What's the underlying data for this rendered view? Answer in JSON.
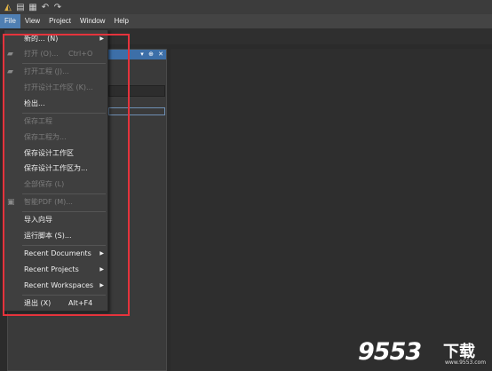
{
  "menubar": {
    "items": [
      {
        "label": "File",
        "active": true
      },
      {
        "label": "View",
        "active": false
      },
      {
        "label": "Project",
        "active": false
      },
      {
        "label": "Window",
        "active": false
      },
      {
        "label": "Help",
        "active": false
      }
    ]
  },
  "toolbar": {
    "icons": [
      "app-logo-icon",
      "copy-icon",
      "save-all-icon",
      "undo-icon",
      "redo-icon"
    ]
  },
  "panel": {
    "controls": [
      "pin-icon",
      "menu-icon",
      "close-icon"
    ]
  },
  "file_menu": {
    "items": [
      {
        "label": "新的... (N)",
        "shortcut": "",
        "submenu": true,
        "enabled": true
      },
      {
        "label": "打开 (O)...",
        "shortcut": "Ctrl+O",
        "submenu": false,
        "enabled": false,
        "icon": "folder-icon"
      },
      {
        "label": "打开工程 (J)...",
        "shortcut": "",
        "submenu": false,
        "enabled": false,
        "icon": "project-icon"
      },
      {
        "label": "打开设计工作区 (K)...",
        "shortcut": "",
        "submenu": false,
        "enabled": false
      },
      {
        "label": "检出...",
        "shortcut": "",
        "submenu": false,
        "enabled": true
      },
      {
        "label": "保存工程",
        "shortcut": "",
        "submenu": false,
        "enabled": false
      },
      {
        "label": "保存工程为...",
        "shortcut": "",
        "submenu": false,
        "enabled": false
      },
      {
        "label": "保存设计工作区",
        "shortcut": "",
        "submenu": false,
        "enabled": true
      },
      {
        "label": "保存设计工作区为...",
        "shortcut": "",
        "submenu": false,
        "enabled": true
      },
      {
        "label": "全部保存 (L)",
        "shortcut": "",
        "submenu": false,
        "enabled": false
      },
      {
        "label": "智能PDF (M)...",
        "shortcut": "",
        "submenu": false,
        "enabled": false,
        "icon": "pdf-icon"
      },
      {
        "label": "导入向导",
        "shortcut": "",
        "submenu": false,
        "enabled": true
      },
      {
        "label": "运行脚本 (S)...",
        "shortcut": "",
        "submenu": false,
        "enabled": true
      },
      {
        "label": "Recent Documents",
        "shortcut": "",
        "submenu": true,
        "enabled": true
      },
      {
        "label": "Recent Projects",
        "shortcut": "",
        "submenu": true,
        "enabled": true
      },
      {
        "label": "Recent Workspaces",
        "shortcut": "",
        "submenu": true,
        "enabled": true
      },
      {
        "label": "退出 (X)",
        "shortcut": "Alt+F4",
        "submenu": false,
        "enabled": true
      }
    ]
  },
  "watermark": {
    "number": "9553",
    "text": "下载",
    "sub": "www.9553.com"
  },
  "colors": {
    "accent": "#4f7fb3",
    "highlight": "#e5333c",
    "panel_header": "#3d6fa8"
  }
}
